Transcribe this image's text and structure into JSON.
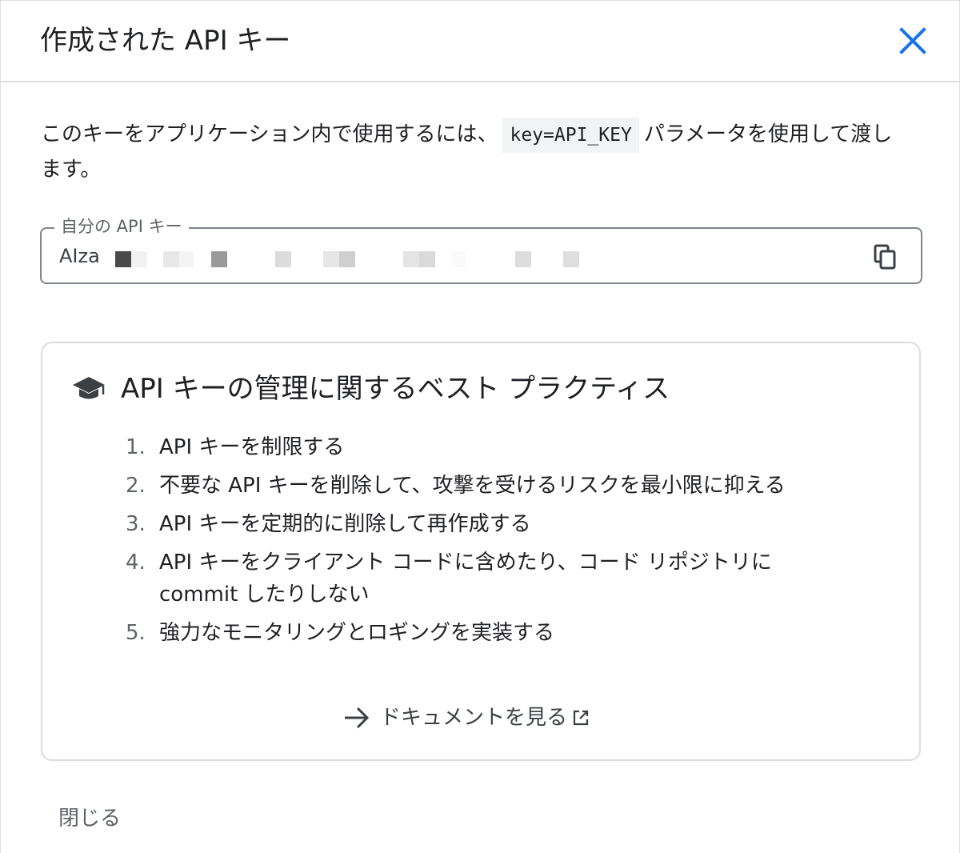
{
  "dialog": {
    "title": "作成された API キー",
    "close_icon": "close-icon"
  },
  "description": {
    "before": "このキーをアプリケーション内で使用するには、",
    "code": "key=API_KEY",
    "after": "パラメータを使用して渡します。"
  },
  "key_field": {
    "label": "自分の API キー",
    "value_prefix": "AIza",
    "copy_icon": "copy-icon"
  },
  "practices": {
    "icon": "graduation-cap-icon",
    "title": "API キーの管理に関するベスト プラクティス",
    "items": [
      {
        "num": "1.",
        "text": "API キーを制限する"
      },
      {
        "num": "2.",
        "text": "不要な API キーを削除して、攻撃を受けるリスクを最小限に抑える"
      },
      {
        "num": "3.",
        "text": "API キーを定期的に削除して再作成する"
      },
      {
        "num": "4.",
        "text": "API キーをクライアント コードに含めたり、コード リポジトリに commit したりしない"
      },
      {
        "num": "5.",
        "text": "強力なモニタリングとロギングを実装する"
      }
    ],
    "doc_link": "ドキュメントを見る"
  },
  "footer": {
    "close_label": "閉じる"
  },
  "colors": {
    "close_icon": "#1a73e8",
    "text": "#202124",
    "muted": "#5f6368",
    "border": "#dadce0"
  }
}
